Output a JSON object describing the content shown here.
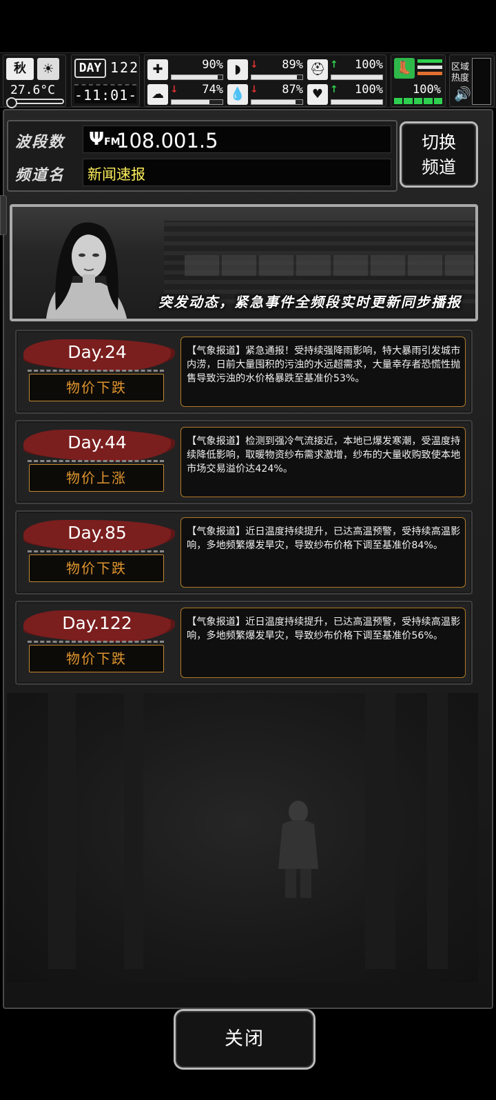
{
  "hud": {
    "season": "秋",
    "temperature": "27.6°C",
    "day_label": "DAY",
    "day_number": "122",
    "clock": "-11:01-",
    "stats": [
      {
        "icon": "medkit-icon",
        "glyph": "✚",
        "arrow": "",
        "value": "90%",
        "fill": 0.9
      },
      {
        "icon": "stomach-icon",
        "glyph": "◗",
        "arrow": "down",
        "value": "89%",
        "fill": 0.89
      },
      {
        "icon": "helmet-icon",
        "glyph": "⛑",
        "arrow": "up",
        "value": "100%",
        "fill": 1.0
      },
      {
        "icon": "brain-icon",
        "glyph": "☁",
        "arrow": "down",
        "value": "74%",
        "fill": 0.74
      },
      {
        "icon": "water-drop-icon",
        "glyph": "💧",
        "arrow": "down",
        "value": "87%",
        "fill": 0.87
      },
      {
        "icon": "heart-icon",
        "glyph": "♥",
        "arrow": "up",
        "value": "100%",
        "fill": 1.0
      }
    ],
    "stamina": "100%",
    "area_label": "区域热度"
  },
  "radio": {
    "band_label": "波段数",
    "frequency": "108.001.5",
    "channel_label": "频道名",
    "channel_name": "新闻速报",
    "switch_label_1": "切换",
    "switch_label_2": "频道"
  },
  "banner": {
    "text": "突发动态，紧急事件全频段实时更新同步播报"
  },
  "events": [
    {
      "day": "Day.24",
      "tag": "物价下跌",
      "text": "【气象报道】紧急通报！受持续强降雨影响，特大暴雨引发城市内涝，日前大量囤积的污浊的水远超需求，大量幸存者恐慌性抛售导致污浊的水价格暴跌至基准价53%。"
    },
    {
      "day": "Day.44",
      "tag": "物价上涨",
      "text": "【气象报道】检测到强冷气流接近，本地已爆发寒潮，受温度持续降低影响，取暖物资纱布需求激增，纱布的大量收购致使本地市场交易溢价达424%。"
    },
    {
      "day": "Day.85",
      "tag": "物价下跌",
      "text": "【气象报道】近日温度持续提升，已达高温预警，受持续高温影响，多地频繁爆发旱灾，导致纱布价格下调至基准价84%。"
    },
    {
      "day": "Day.122",
      "tag": "物价下跌",
      "text": "【气象报道】近日温度持续提升，已达高温预警，受持续高温影响，多地频繁爆发旱灾，导致纱布价格下调至基准价56%。"
    }
  ],
  "close_label": "关闭",
  "colors": {
    "accent_gold": "#c4892f",
    "brush_red": "#7b1e1e",
    "up_green": "#2fd04f",
    "down_red": "#e03030",
    "channel_yellow": "#ffef5a"
  }
}
